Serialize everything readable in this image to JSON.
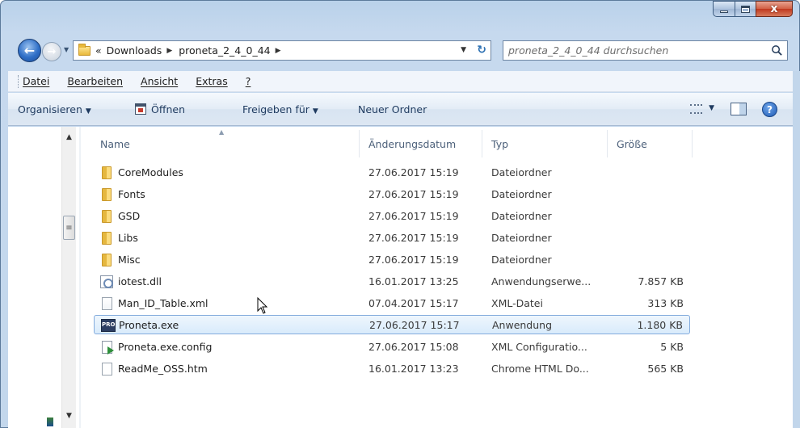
{
  "window": {
    "caption_close": "x"
  },
  "navigation": {
    "back_glyph": "←",
    "forward_glyph": "→",
    "breadcrumb_prefix": "«",
    "breadcrumbs": [
      "Downloads",
      "proneta_2_4_0_44"
    ],
    "refresh_glyph": "↻",
    "search_placeholder": "proneta_2_4_0_44 durchsuchen"
  },
  "menubar": {
    "items": [
      "Datei",
      "Bearbeiten",
      "Ansicht",
      "Extras",
      "?"
    ]
  },
  "commandbar": {
    "organize": "Organisieren",
    "open": "Öffnen",
    "share": "Freigeben für",
    "new_folder": "Neuer Ordner",
    "help_glyph": "?"
  },
  "list": {
    "columns": {
      "name": "Name",
      "date": "Änderungsdatum",
      "type": "Typ",
      "size": "Größe"
    },
    "rows": [
      {
        "name": "CoreModules",
        "date": "27.06.2017 15:19",
        "type": "Dateiordner",
        "size": "",
        "icon": "folder-icon"
      },
      {
        "name": "Fonts",
        "date": "27.06.2017 15:19",
        "type": "Dateiordner",
        "size": "",
        "icon": "folder-icon"
      },
      {
        "name": "GSD",
        "date": "27.06.2017 15:19",
        "type": "Dateiordner",
        "size": "",
        "icon": "folder-icon"
      },
      {
        "name": "Libs",
        "date": "27.06.2017 15:19",
        "type": "Dateiordner",
        "size": "",
        "icon": "folder-icon"
      },
      {
        "name": "Misc",
        "date": "27.06.2017 15:19",
        "type": "Dateiordner",
        "size": "",
        "icon": "folder-icon"
      },
      {
        "name": "iotest.dll",
        "date": "16.01.2017 13:25",
        "type": "Anwendungserwe...",
        "size": "7.857 KB",
        "icon": "dll-icon"
      },
      {
        "name": "Man_ID_Table.xml",
        "date": "07.04.2017 15:17",
        "type": "XML-Datei",
        "size": "313 KB",
        "icon": "xml-file-icon"
      },
      {
        "name": "Proneta.exe",
        "date": "27.06.2017 15:17",
        "type": "Anwendung",
        "size": "1.180 KB",
        "icon": "exe-icon",
        "selected": true
      },
      {
        "name": "Proneta.exe.config",
        "date": "27.06.2017 15:08",
        "type": "XML Configuratio...",
        "size": "5 KB",
        "icon": "config-file-icon"
      },
      {
        "name": "ReadMe_OSS.htm",
        "date": "16.01.2017 13:23",
        "type": "Chrome HTML Do...",
        "size": "565 KB",
        "icon": "htm-file-icon"
      }
    ]
  },
  "colors": {
    "selection_fill": "#d9ebfb",
    "selection_border": "#84acdd",
    "command_text": "#1e3a5f"
  }
}
